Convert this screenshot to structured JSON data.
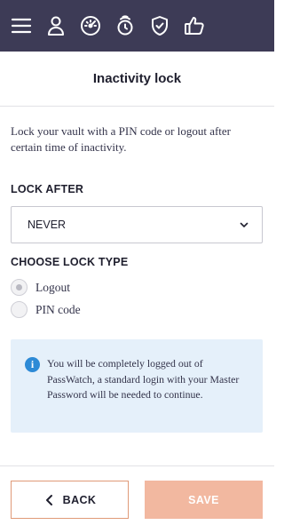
{
  "nav": {
    "items": [
      {
        "name": "menu-icon",
        "icon": "hamburger"
      },
      {
        "name": "user-icon",
        "icon": "person"
      },
      {
        "name": "dashboard-icon",
        "icon": "gauge"
      },
      {
        "name": "watch-icon",
        "icon": "watch"
      },
      {
        "name": "shield-icon",
        "icon": "shield-check"
      },
      {
        "name": "thumbs-up-icon",
        "icon": "thumbs-up"
      }
    ],
    "background": "#3d3b56"
  },
  "page": {
    "title": "Inactivity lock",
    "description": "Lock your vault with a PIN code or logout after certain time of inactivity."
  },
  "lock_after": {
    "label": "LOCK AFTER",
    "selected": "NEVER"
  },
  "lock_type": {
    "label": "CHOOSE LOCK TYPE",
    "options": [
      {
        "label": "Logout",
        "selected": true
      },
      {
        "label": "PIN code",
        "selected": false
      }
    ]
  },
  "info": {
    "icon": "info-icon",
    "text": "You will be completely logged out of PassWatch, a standard login with your Master Password will be needed to continue."
  },
  "footer": {
    "back_label": "BACK",
    "save_label": "SAVE",
    "accent": "#e09a78",
    "save_color": "#f2b8a0"
  }
}
